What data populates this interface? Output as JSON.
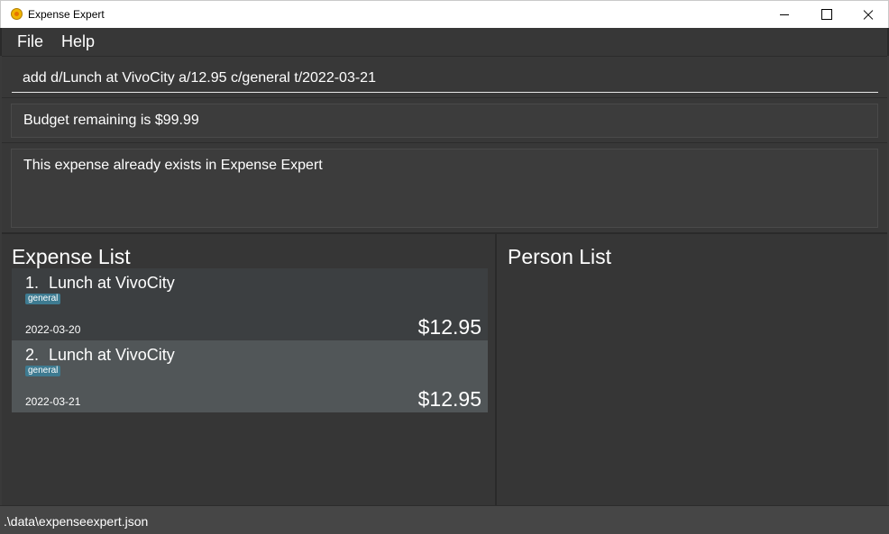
{
  "window": {
    "title": "Expense Expert"
  },
  "menu": {
    "file_label": "File",
    "help_label": "Help"
  },
  "command": {
    "value": "add d/Lunch at VivoCity a/12.95 c/general t/2022-03-21"
  },
  "budget": {
    "text": "Budget remaining is $99.99"
  },
  "result": {
    "text": "This expense already exists in Expense Expert"
  },
  "expense_list": {
    "heading": "Expense List",
    "items": [
      {
        "index": "1.",
        "description": "Lunch at VivoCity",
        "tag": "general",
        "date": "2022-03-20",
        "amount": "$12.95"
      },
      {
        "index": "2.",
        "description": "Lunch at VivoCity",
        "tag": "general",
        "date": "2022-03-21",
        "amount": "$12.95"
      }
    ]
  },
  "person_list": {
    "heading": "Person List"
  },
  "status": {
    "path": ".\\data\\expenseexpert.json"
  },
  "colors": {
    "background": "#3a3a3a",
    "card": "#3c3f41",
    "card_selected": "#515658",
    "tag": "#3e7b91",
    "text": "#ffffff"
  }
}
